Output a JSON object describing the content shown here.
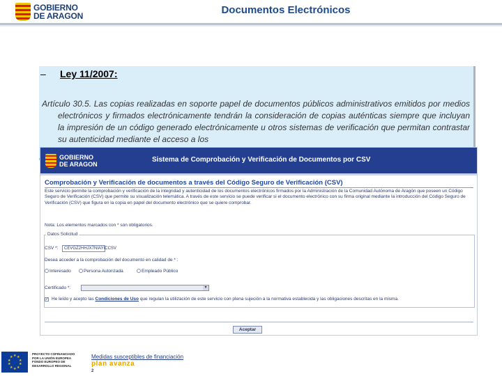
{
  "header": {
    "logo_line1": "GOBIERNO",
    "logo_line2": "DE ARAGON",
    "title": "Documentos Electrónicos"
  },
  "slide": {
    "bullet_dash": "–",
    "law_title": "Ley 11/2007:",
    "article_text": "Artículo 30.5. Las copias realizadas en soporte papel de documentos públicos administrativos emitidos por medios electrónicos y firmados electrónicamente tendrán la consideración de copias auténticas siempre que incluyan la impresión de un código generado electrónicamente u otros sistemas de verificación que permitan contrastar su autenticidad mediante el acceso a los"
  },
  "embedded": {
    "logo_line1": "GOBIERNO",
    "logo_line2": "DE ARAGON",
    "system_title": "Sistema de Comprobación y Verificación de Documentos por CSV",
    "subtitle": "Comprobación y Verificación de documentos a través del Código Seguro de Verificación (CSV)",
    "intro": "Este servicio permite la comprobación y verificación de la integridad y autenticidad de los documentos electrónicos firmados por la Administración de la Comunidad Autónoma de Aragón que poseen un Código Seguro de Verificación (CSV) que permite su visualización telemática. A través de este servicio se puede verificar si el documento electrónico con su firma original mediante la introducción del Código Seguro de Verificación (CSV) que figura en la copia en papel del documento electrónico que se quiere comprobar.",
    "note": "Nota: Los elementos marcados con * son obligatorios.",
    "legend": "Datos Solicitud",
    "csv_label": "CSV *:",
    "csv_value": "CEVGZ2HHJX7NIAYICCSV",
    "access_question": "Desea acceder a la comprobación del documento en calidad de * :",
    "radio_options": [
      "Interesado",
      "Persona Autorizada",
      "Empleado Público"
    ],
    "cert_label": "Certificado *:",
    "consent_prefix": "He leído y acepto las",
    "consent_link": "Condiciones de Uso",
    "consent_suffix": "que regulan la utilización de este servicio con plena sujeción a la normativa establecida y las obligaciones descritas en la misma.",
    "accept_button": "Aceptar"
  },
  "footer": {
    "eu_text": "PROYECTO COFINANCIADO POR LA UNIÓN EUROPEA FONDO EUROPEO DE DESARROLLO REGIONAL",
    "funding_label": "Medidas susceptibles de financiación",
    "plan_logo": "plan avanza",
    "plan_small": "2"
  }
}
